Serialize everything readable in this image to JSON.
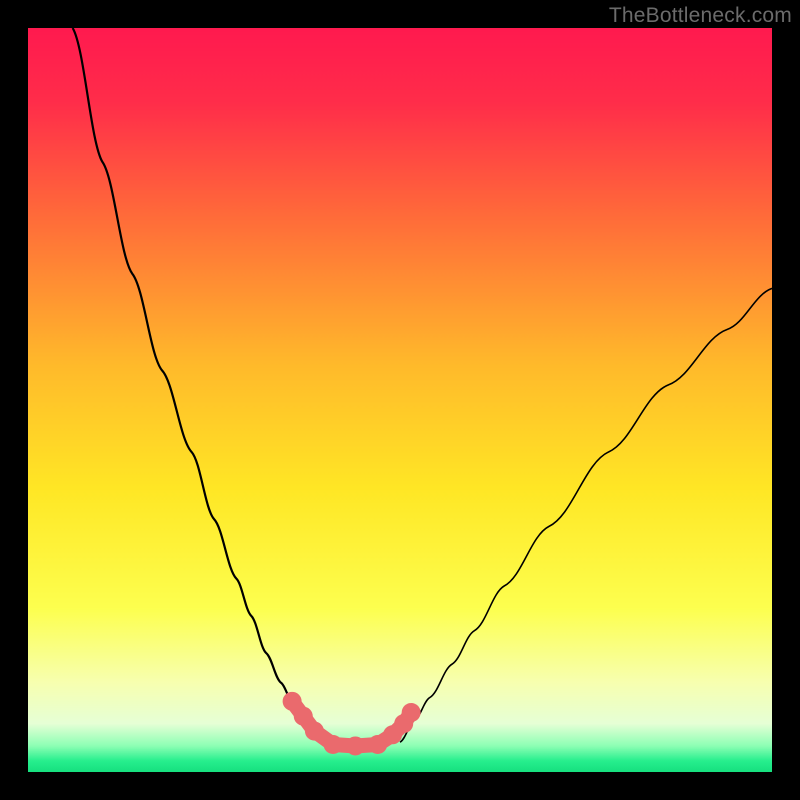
{
  "watermark": "TheBottleneck.com",
  "colors": {
    "gradient_stops": [
      {
        "offset": 0.0,
        "color": "#ff1a4f"
      },
      {
        "offset": 0.1,
        "color": "#ff2d4a"
      },
      {
        "offset": 0.25,
        "color": "#ff6a3a"
      },
      {
        "offset": 0.45,
        "color": "#ffb92b"
      },
      {
        "offset": 0.62,
        "color": "#ffe725"
      },
      {
        "offset": 0.78,
        "color": "#fdff4f"
      },
      {
        "offset": 0.88,
        "color": "#f7ffb0"
      },
      {
        "offset": 0.935,
        "color": "#e6ffd6"
      },
      {
        "offset": 0.965,
        "color": "#8dffb4"
      },
      {
        "offset": 0.985,
        "color": "#27ef8e"
      },
      {
        "offset": 1.0,
        "color": "#16e07f"
      }
    ],
    "curve": "#000000",
    "marker": "#ea6a6d",
    "frame": "#000000"
  },
  "chart_data": {
    "type": "line",
    "title": "",
    "xlabel": "",
    "ylabel": "",
    "xlim": [
      0,
      100
    ],
    "ylim": [
      0,
      100
    ],
    "note": "No axes or tick labels are rendered; values are normalized 0–100 against the plot box. y increases downward in pixel space.",
    "series": [
      {
        "name": "left-curve",
        "x": [
          6,
          10,
          14,
          18,
          22,
          25,
          28,
          30,
          32,
          34,
          35.5,
          37,
          38.5,
          40
        ],
        "y": [
          0,
          18,
          33,
          46,
          57,
          66,
          74,
          79,
          84,
          88,
          90.5,
          92.5,
          94,
          96
        ]
      },
      {
        "name": "right-curve",
        "x": [
          50,
          52,
          54,
          57,
          60,
          64,
          70,
          78,
          86,
          94,
          100
        ],
        "y": [
          96,
          93,
          90,
          85.5,
          81,
          75,
          67,
          57,
          48,
          40.5,
          35
        ]
      },
      {
        "name": "valley-markers",
        "x": [
          35.5,
          37,
          38.5,
          41,
          44,
          47,
          49,
          50.5,
          51.5
        ],
        "y": [
          90.5,
          92.5,
          94.5,
          96.3,
          96.5,
          96.3,
          95,
          93.5,
          92
        ]
      }
    ]
  }
}
